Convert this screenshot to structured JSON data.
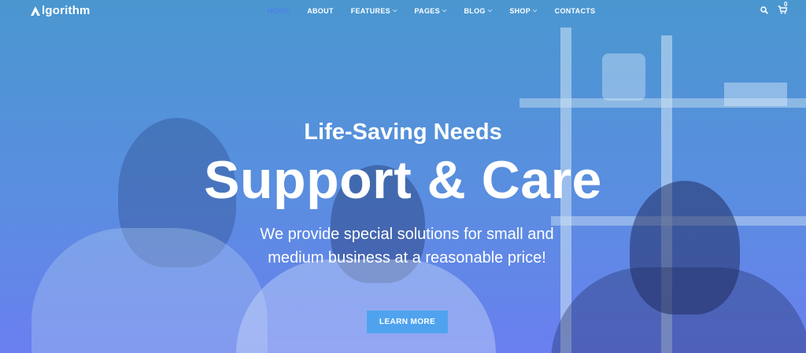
{
  "brand": {
    "name": "lgorithm"
  },
  "nav": {
    "items": [
      {
        "label": "HOME",
        "active": true,
        "dropdown": false
      },
      {
        "label": "ABOUT",
        "active": false,
        "dropdown": false
      },
      {
        "label": "FEATURES",
        "active": false,
        "dropdown": true
      },
      {
        "label": "PAGES",
        "active": false,
        "dropdown": true
      },
      {
        "label": "BLOG",
        "active": false,
        "dropdown": true
      },
      {
        "label": "SHOP",
        "active": false,
        "dropdown": true
      },
      {
        "label": "CONTACTS",
        "active": false,
        "dropdown": false
      }
    ],
    "cart_count": "0"
  },
  "hero": {
    "tagline": "Life-Saving Needs",
    "headline": "Support & Care",
    "subtext": "We provide special solutions for small and medium business at a reasonable price!",
    "cta_label": "LEARN MORE"
  },
  "colors": {
    "active_nav": "#4f7fe8",
    "button": "#4fa3ee",
    "overlay_top": "#4a97d0",
    "overlay_bottom": "#6a7ff0"
  }
}
